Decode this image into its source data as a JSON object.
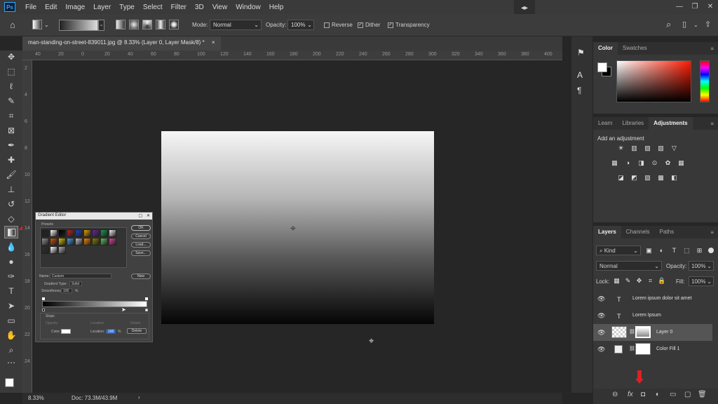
{
  "app": {
    "logo": "Ps",
    "menu": [
      "File",
      "Edit",
      "Image",
      "Layer",
      "Type",
      "Select",
      "Filter",
      "3D",
      "View",
      "Window",
      "Help"
    ],
    "window_controls": [
      "—",
      "❐",
      "✕"
    ]
  },
  "options_bar": {
    "mode_label": "Mode:",
    "mode_value": "Normal",
    "opacity_label": "Opacity:",
    "opacity_value": "100%",
    "reverse_label": "Reverse",
    "dither_label": "Dither",
    "transparency_label": "Transparency"
  },
  "document": {
    "tab_title": "man-standing-on-street-839011.jpg @ 8.33% (Layer 0, Layer Mask/8) *",
    "tab_close": "×",
    "zoom": "8.33%",
    "doc_info": "Doc: 73.3M/43.9M",
    "ruler_h": [
      "40",
      "20",
      "0",
      "20",
      "40",
      "60",
      "80",
      "100",
      "120",
      "140",
      "160",
      "180",
      "200",
      "220",
      "240",
      "260",
      "280",
      "300",
      "320",
      "340",
      "360",
      "380",
      "400"
    ],
    "ruler_v": [
      "2",
      "4",
      "6",
      "8",
      "10",
      "12",
      "14",
      "16",
      "18",
      "20",
      "22",
      "24"
    ]
  },
  "gradient_editor": {
    "title": "Gradient Editor",
    "presets_label": "Presets",
    "ok": "OK",
    "cancel": "Cancel",
    "load": "Load...",
    "save": "Save...",
    "name_label": "Name:",
    "name_value": "Custom",
    "new_button": "New",
    "type_label": "Gradient Type:",
    "type_value": "Solid",
    "smooth_label": "Smoothness:",
    "smooth_value": "100",
    "smooth_unit": "%",
    "stops_label": "Stops",
    "opacity_label": "Opacity:",
    "location_label": "Location:",
    "delete_label": "Delete",
    "color_label": "Color:",
    "color_location_value": "100",
    "percent": "%",
    "swatches": [
      "#222222",
      "#ffffff",
      "#000000",
      "#c02020",
      "#2040c0",
      "#e0a000",
      "#7020a0",
      "#10a050",
      "#f0f0f0",
      "#909090",
      "#d05010",
      "#d8c000",
      "#40a0e0",
      "#c0c0c0",
      "#ff8000",
      "#808000",
      "#60c060",
      "#e040a0",
      "#303030",
      "#ffffff",
      "#b0b0b0"
    ]
  },
  "color_panel": {
    "tabs": [
      "Color",
      "Swatches"
    ],
    "active": "Color"
  },
  "adjustments_panel": {
    "tabs": [
      "Learn",
      "Libraries",
      "Adjustments"
    ],
    "heading": "Add an adjustment",
    "row1": [
      "☀",
      "▥",
      "▨",
      "▧",
      "▽"
    ],
    "row2": [
      "▦",
      "◑",
      "◨",
      "⊙",
      "✿",
      "▦"
    ],
    "row3": [
      "◪",
      "◩",
      "▧",
      "▩",
      "◧"
    ]
  },
  "layers_panel": {
    "tabs": [
      "Layers",
      "Channels",
      "Paths"
    ],
    "kind_label": "Kind",
    "blend_mode": "Normal",
    "opacity_label": "Opacity:",
    "opacity_value": "100%",
    "lock_label": "Lock:",
    "fill_label": "Fill:",
    "fill_value": "100%",
    "layers": [
      {
        "name": "Lorem ipsum dolor sit amet",
        "type": "T"
      },
      {
        "name": "Lorem Ipsum",
        "type": "T"
      },
      {
        "name": "Layer 0",
        "type": "image"
      },
      {
        "name": "Color Fill 1",
        "type": "fill"
      }
    ],
    "footer_icons": [
      "⊖",
      "fx",
      "◘",
      "◐",
      "▭",
      "▢",
      "🗑"
    ]
  }
}
